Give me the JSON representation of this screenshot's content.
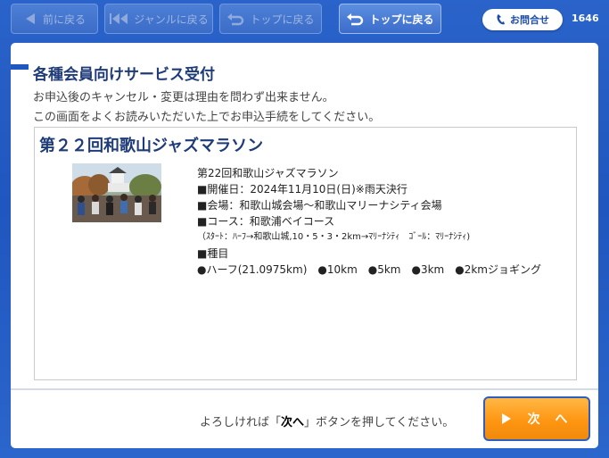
{
  "nav": {
    "back_label": "前に戻る",
    "genre_label": "ジャンルに戻る",
    "top_label_disabled": "トップに戻る",
    "top_label": "トップに戻る",
    "contact_label": "お問合せ",
    "terminal_id": "1646"
  },
  "page": {
    "title": "各種会員向けサービス受付",
    "note1": "お申込後のキャンセル・変更は理由を問わず出来ません。",
    "note2": "この画面をよくお読みいただいた上でお申込手続をしてください。"
  },
  "event": {
    "title": "第２２回和歌山ジャズマラソン",
    "lines": [
      "第22回和歌山ジャズマラソン",
      "■開催日：2024年11月10日(日)※雨天決行",
      "■会場：和歌山城会場〜和歌山マリーナシティ会場",
      "■コース：和歌浦ベイコース",
      "（ｽﾀｰﾄ：ﾊｰﾌ→和歌山城,10・5・3・2km→ﾏﾘｰﾅｼﾃｨ　ｺﾞｰﾙ：ﾏﾘｰﾅｼﾃｨ)",
      "■種目",
      "●ハーフ(21.0975km)　●10km　●5km　●3km　●2kmジョギング"
    ]
  },
  "footer": {
    "prefix": "よろしければ「",
    "emphasis": "次へ",
    "suffix": "」ボタンを押してください。",
    "next_label": "次 へ"
  },
  "colors": {
    "background": "#1f56bf",
    "title_text": "#1f3b78",
    "next_button": "#ff9612"
  }
}
